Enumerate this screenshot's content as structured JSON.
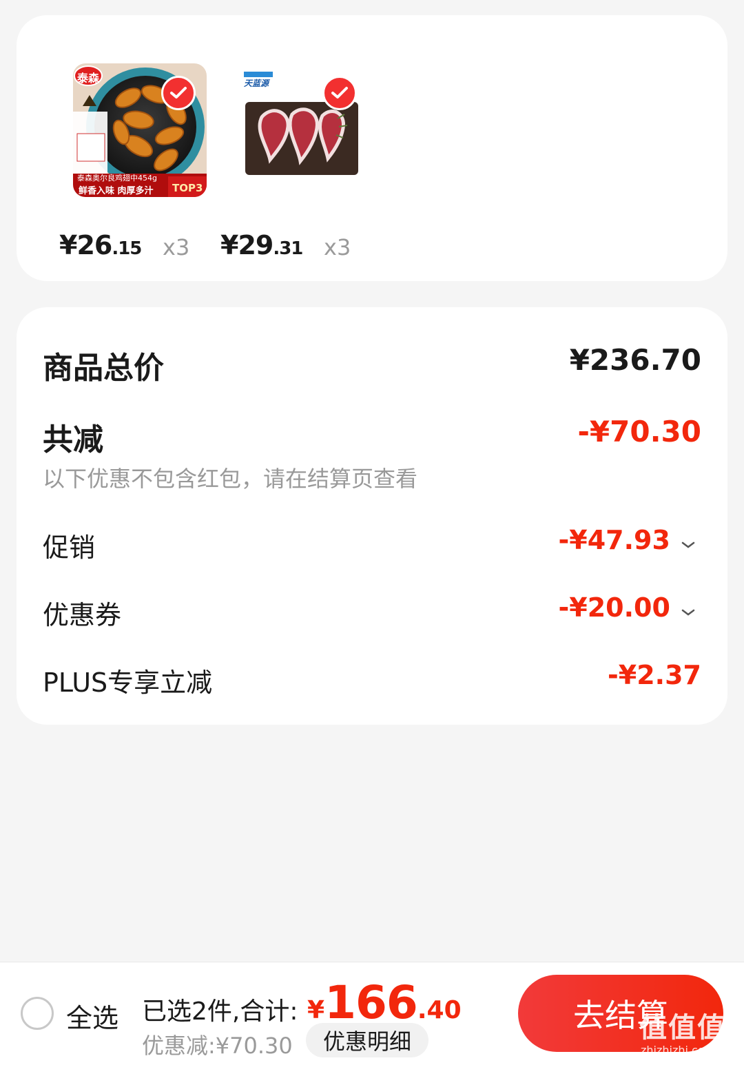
{
  "products": [
    {
      "brand": "泰森",
      "caption": "泰森奥尔良鸡翅中454g",
      "tagline": "鲜香入味  肉厚多汁",
      "badge": "TOP3",
      "price_int": "¥26",
      "price_dec": ".15",
      "qty": "x3",
      "selected": true
    },
    {
      "brand": "天蓝源",
      "price_int": "¥29",
      "price_dec": ".31",
      "qty": "x3",
      "selected": true
    }
  ],
  "summary": {
    "total_label": "商品总价",
    "total_value": "¥236.70",
    "discount_label": "共减",
    "discount_value": "-¥70.30",
    "note": "以下优惠不包含红包，请在结算页查看",
    "promo_label": "促销",
    "promo_value": "-¥47.93",
    "coupon_label": "优惠券",
    "coupon_value": "-¥20.00",
    "plus_label": "PLUS专享立减",
    "plus_value": "-¥2.37"
  },
  "bottom_bar": {
    "select_all": "全选",
    "selected_text": "已选2件,合计:",
    "total_yen": "¥",
    "total_int": "166",
    "total_dec": ".40",
    "discount_text": "优惠减:¥70.30",
    "detail_button": "优惠明细",
    "checkout_button": "去结算"
  },
  "watermark": {
    "text": "值值值",
    "url": "zhizhizhi.com"
  },
  "colors": {
    "accent_red": "#f2270c",
    "background": "#f5f5f5"
  }
}
